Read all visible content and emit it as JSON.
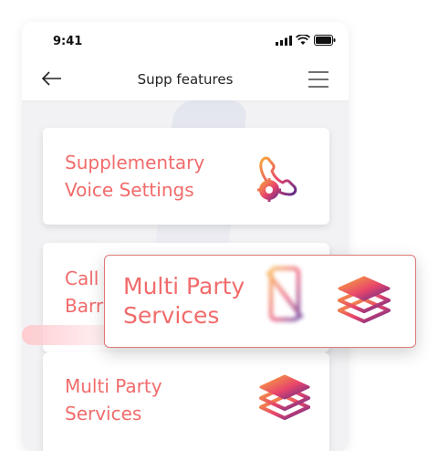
{
  "status_bar": {
    "time": "9:41"
  },
  "header": {
    "title": "Supp features"
  },
  "cards": [
    {
      "label": "Supplementary\nVoice Settings",
      "icon": "phone-settings-icon"
    },
    {
      "label": "Call\nBarr",
      "icon": "phone-blocked-icon"
    },
    {
      "label": "Multi Party\nServices",
      "icon": "layers-icon"
    }
  ],
  "popup": {
    "label": "Multi Party\nServices",
    "icon": "layers-icon"
  },
  "colors": {
    "accent": "#f26b6b",
    "gradient_start": "#f7a93b",
    "gradient_mid": "#e8456b",
    "gradient_end": "#5b2a8c"
  }
}
